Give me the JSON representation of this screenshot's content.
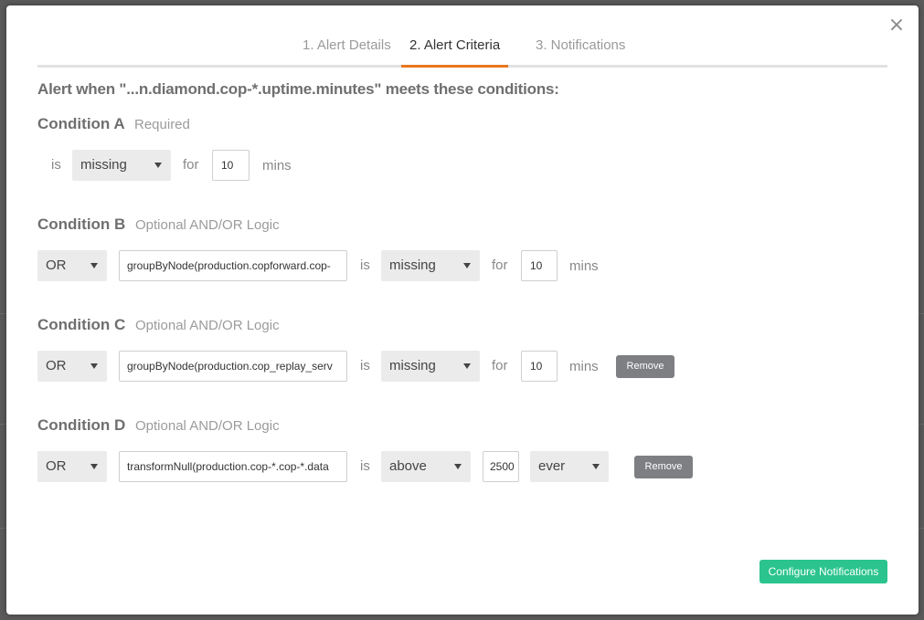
{
  "tabs": [
    {
      "label": "1. Alert Details"
    },
    {
      "label": "2. Alert Criteria"
    },
    {
      "label": "3. Notifications"
    }
  ],
  "headline": "Alert when \"...n.diamond.cop-*.uptime.minutes\" meets these conditions:",
  "condition_a": {
    "title": "Condition A",
    "subtitle": "Required",
    "is_label": "is",
    "state": "missing",
    "for_label": "for",
    "duration": "10",
    "unit": "mins"
  },
  "condition_b": {
    "title": "Condition B",
    "subtitle": "Optional AND/OR Logic",
    "logic": "OR",
    "query": "groupByNode(production.copforward.cop-",
    "is_label": "is",
    "state": "missing",
    "for_label": "for",
    "duration": "10",
    "unit": "mins"
  },
  "condition_c": {
    "title": "Condition C",
    "subtitle": "Optional AND/OR Logic",
    "logic": "OR",
    "query": "groupByNode(production.cop_replay_serv",
    "is_label": "is",
    "state": "missing",
    "for_label": "for",
    "duration": "10",
    "unit": "mins",
    "remove_label": "Remove"
  },
  "condition_d": {
    "title": "Condition D",
    "subtitle": "Optional AND/OR Logic",
    "logic": "OR",
    "query": "transformNull(production.cop-*.cop-*.data",
    "is_label": "is",
    "state": "above",
    "threshold": "2500",
    "time": "ever",
    "remove_label": "Remove"
  },
  "configure_label": "Configure Notifications",
  "close_glyph": "×",
  "colors": {
    "accent_tab": "#e8771d",
    "primary_button": "#2bc48f",
    "remove_button": "#7d7f83"
  }
}
